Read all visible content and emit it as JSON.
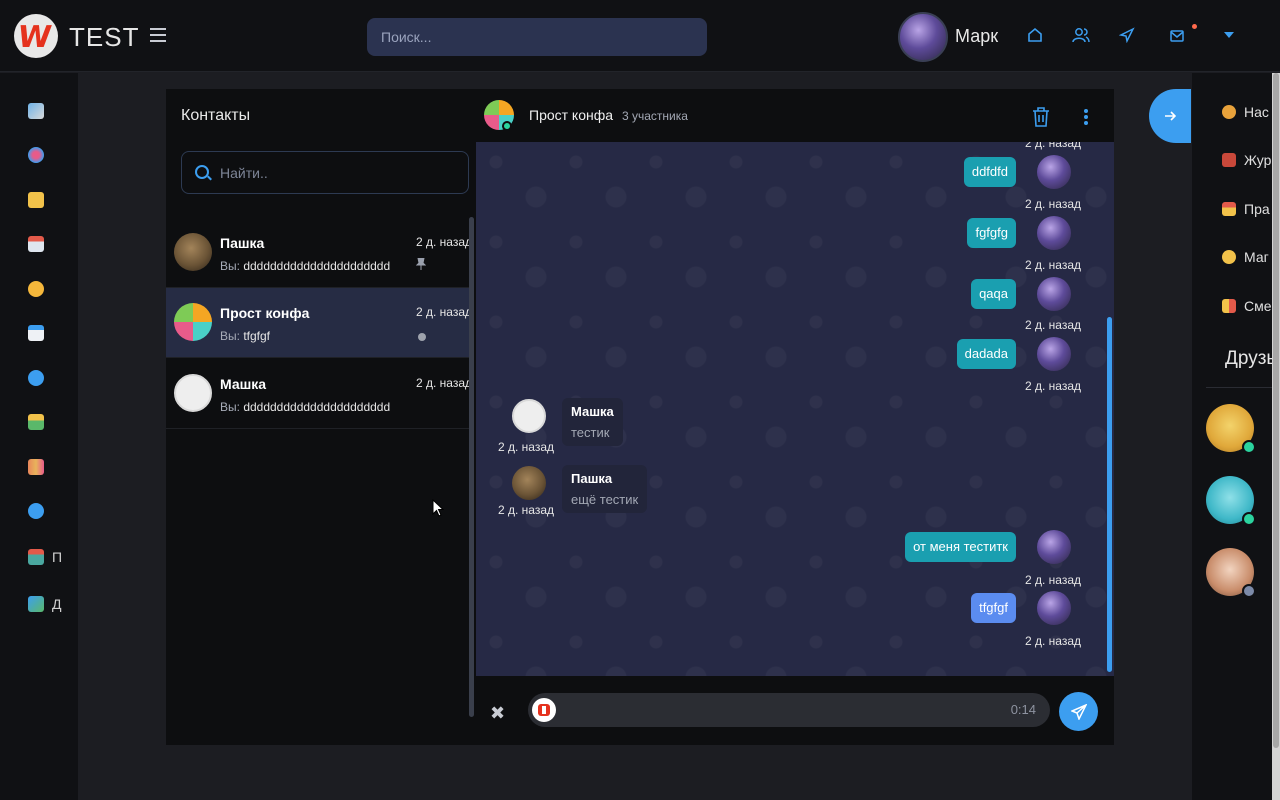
{
  "header": {
    "brand": "TEST",
    "search_placeholder": "Поиск...",
    "user_name": "Марк"
  },
  "sidebar": {
    "items": [
      {
        "icon": "map-icon",
        "label": ""
      },
      {
        "icon": "bubbles-icon",
        "label": ""
      },
      {
        "icon": "folder-download-icon",
        "label": ""
      },
      {
        "icon": "news-icon",
        "label": ""
      },
      {
        "icon": "emoji-icon",
        "label": ""
      },
      {
        "icon": "blog-icon",
        "label": ""
      },
      {
        "icon": "chat-icon",
        "label": ""
      },
      {
        "icon": "image-icon",
        "label": ""
      },
      {
        "icon": "group-icon",
        "label": ""
      },
      {
        "icon": "info-icon",
        "label": ""
      },
      {
        "icon": "shop-icon",
        "label": "П"
      },
      {
        "icon": "box-add-icon",
        "label": "Д"
      }
    ]
  },
  "contacts": {
    "title": "Контакты",
    "search_placeholder": "Найти..",
    "you_prefix": "Вы:",
    "items": [
      {
        "name": "Пашка",
        "preview": "dddddddddddddddddddddd...",
        "time": "2 д. назад",
        "pinned": true
      },
      {
        "name": "Прост конфа",
        "preview": "tfgfgf",
        "time": "2 д. назад",
        "active": true
      },
      {
        "name": "Машка",
        "preview": "dddddddddddddddddddddd...",
        "time": "2 д. назад"
      }
    ]
  },
  "chat": {
    "title": "Прост конфа",
    "members": "3 участника",
    "top_time": "2 д. назад",
    "outgoing": [
      {
        "text": "ddfdfd",
        "time": "2 д. назад"
      },
      {
        "text": "fgfgfg",
        "time": "2 д. назад"
      },
      {
        "text": "qaqa",
        "time": "2 д. назад"
      },
      {
        "text": "dadada",
        "time": "2 д. назад"
      }
    ],
    "incoming": [
      {
        "from": "Машка",
        "text": "тестик",
        "time": "2 д. назад"
      },
      {
        "from": "Пашка",
        "text": "ещё тестик",
        "time": "2 д. назад"
      }
    ],
    "outgoing_late": [
      {
        "text": "от меня теститк",
        "time": "2 д. назад"
      },
      {
        "text": "tfgfgf",
        "time": "2 д. назад"
      }
    ],
    "recording": {
      "duration": "0:14"
    }
  },
  "right_panel": {
    "items": [
      {
        "icon": "gear-icon",
        "label": "Нас"
      },
      {
        "icon": "journal-icon",
        "label": "Жур"
      },
      {
        "icon": "rules-icon",
        "label": "Пра"
      },
      {
        "icon": "shop-icon",
        "label": "Маг"
      },
      {
        "icon": "swap-icon",
        "label": "Сме"
      }
    ],
    "friends_title": "Друзь"
  },
  "colors": {
    "accent": "#3c9ef0",
    "bubble_out": "#1a9fb0",
    "bubble_out_last": "#5b8cf0",
    "online": "#2bd49f"
  }
}
